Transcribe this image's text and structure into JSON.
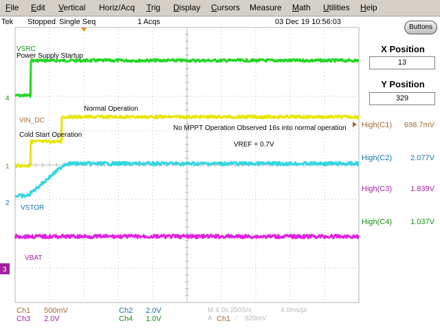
{
  "menu": [
    {
      "label": "File",
      "u": "F",
      "rest": "ile"
    },
    {
      "label": "Edit",
      "u": "E",
      "rest": "dit"
    },
    {
      "label": "Vertical",
      "u": "V",
      "rest": "ertical"
    },
    {
      "label": "Horiz/Acq",
      "u": "",
      "rest": "Horiz/Acq"
    },
    {
      "label": "Trig",
      "u": "T",
      "rest": "rig"
    },
    {
      "label": "Display",
      "u": "D",
      "rest": "isplay"
    },
    {
      "label": "Cursors",
      "u": "C",
      "rest": "ursors"
    },
    {
      "label": "Measure",
      "u": "",
      "rest": "Measure"
    },
    {
      "label": "Math",
      "u": "M",
      "rest": "ath"
    },
    {
      "label": "Utilities",
      "u": "U",
      "rest": "tilities"
    },
    {
      "label": "Help",
      "u": "H",
      "rest": "elp"
    }
  ],
  "status": {
    "brand": "Tek",
    "state": "Stopped",
    "mode": "Single Seq",
    "acqs": "1 Acqs",
    "datetime": "03 Dec 19 10:56:03"
  },
  "buttons_label": "Buttons",
  "x_position": {
    "title": "X Position",
    "value": "13"
  },
  "y_position": {
    "title": "Y Position",
    "value": "329"
  },
  "measurements": [
    {
      "label": "High(C1)",
      "value": "698.7mV",
      "color": "#a06a2c"
    },
    {
      "label": "High(C2)",
      "value": "2.077V",
      "color": "#1470a8"
    },
    {
      "label": "High(C3)",
      "value": "1.839V",
      "color": "#a020a0"
    },
    {
      "label": "High(C4)",
      "value": "1.037V",
      "color": "#158a15"
    }
  ],
  "annotations": {
    "vsrc": "VSRC",
    "power_supply_startup": "Power Supply Startup",
    "normal_operation": "Normal Operation",
    "vin_dc": "VIN_DC",
    "no_mppt": "No MPPT Operation Observed 16s into normal operation",
    "cold_start": "Cold Start Operation",
    "vref": "VREF = 0.7V",
    "vstor": "VSTOR",
    "vbat": "VBAT"
  },
  "channel_markers": {
    "ch4": "4",
    "ch1": "1",
    "ch2": "2",
    "ch3": "3"
  },
  "readouts": {
    "ch1": {
      "name": "Ch1",
      "scale": "500mV"
    },
    "ch2": {
      "name": "Ch2",
      "scale": "2.0V"
    },
    "ch3": {
      "name": "Ch3",
      "scale": "2.0V"
    },
    "ch4": {
      "name": "Ch4",
      "scale": "1.0V"
    },
    "horiz": "M 4.0s 250S/s",
    "time_per_pt": "4.0ms/pt",
    "trig_mode": "A",
    "trig_source": "Ch1",
    "trig_slope": "⟋",
    "trig_level": "620mV"
  },
  "colors": {
    "ch1": "#e6e600",
    "ch2": "#33d6e0",
    "ch3": "#e020e0",
    "ch4": "#22d622",
    "grid": "#b4b4b4",
    "ch1_label": "#a06a2c",
    "ch2_label": "#1470a8",
    "ch3_label": "#a020a0",
    "ch4_label": "#158a15"
  }
}
